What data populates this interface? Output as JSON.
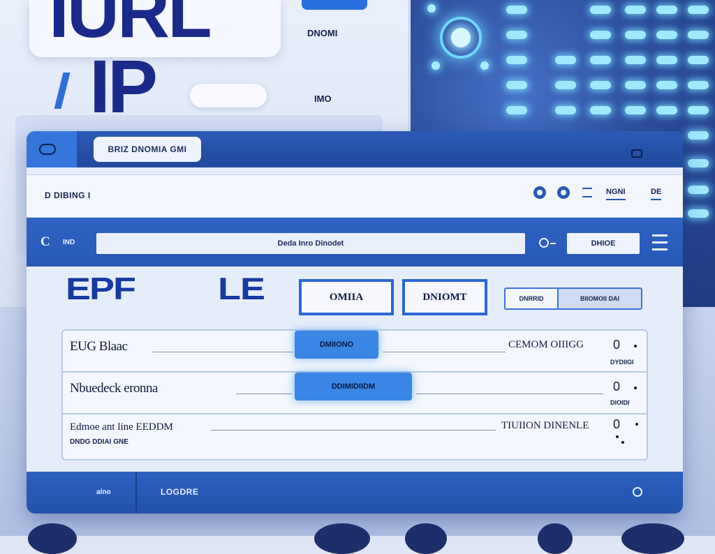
{
  "background": {
    "title_large": "IURL",
    "subtitle_large": "IP",
    "small_text_top": "DNOMI",
    "small_text_mid": "IMO"
  },
  "window": {
    "title_tab": "BRIZ DNOMIA GMI",
    "toolbar": {
      "label": "D DIBING I",
      "link_1": "NGNI",
      "link_2": "DE"
    },
    "address_bar": {
      "logo_mark": "C",
      "logo_label": "IND",
      "url_text": "Deda Inro Dinodet",
      "button_label": "DHIOE"
    },
    "heading": {
      "part_1": "EPF",
      "part_2": "LE"
    },
    "buttons": {
      "outline_1": "OMIIA",
      "outline_2": "DNIOMT"
    },
    "segmented": {
      "option_1": "DNRRID",
      "option_2": "BIIOMOII DAI"
    },
    "rows": [
      {
        "title": "EUG Blaac",
        "pill": "DMIIONO",
        "right_text": "CEMOM OIIIGG",
        "number": "0",
        "sub": "DYDIIGI"
      },
      {
        "title": "Nbuedeck eronna",
        "pill": "DDIMIDIIDM",
        "right_text": "",
        "number": "0",
        "sub": "DIOIDI"
      },
      {
        "title": "Edmoe ant line EEDDM",
        "sub_left": "DNDG DDIAI GNE",
        "right_text": "TIUIION DINENLE",
        "number": "0"
      }
    ],
    "footer": {
      "left_label": "alno",
      "mid_label": "LOGDRE"
    }
  },
  "colors": {
    "primary": "#2b5ab7",
    "accent": "#3a86e4",
    "heading": "#153ba3",
    "panel": "#e6edfa"
  }
}
